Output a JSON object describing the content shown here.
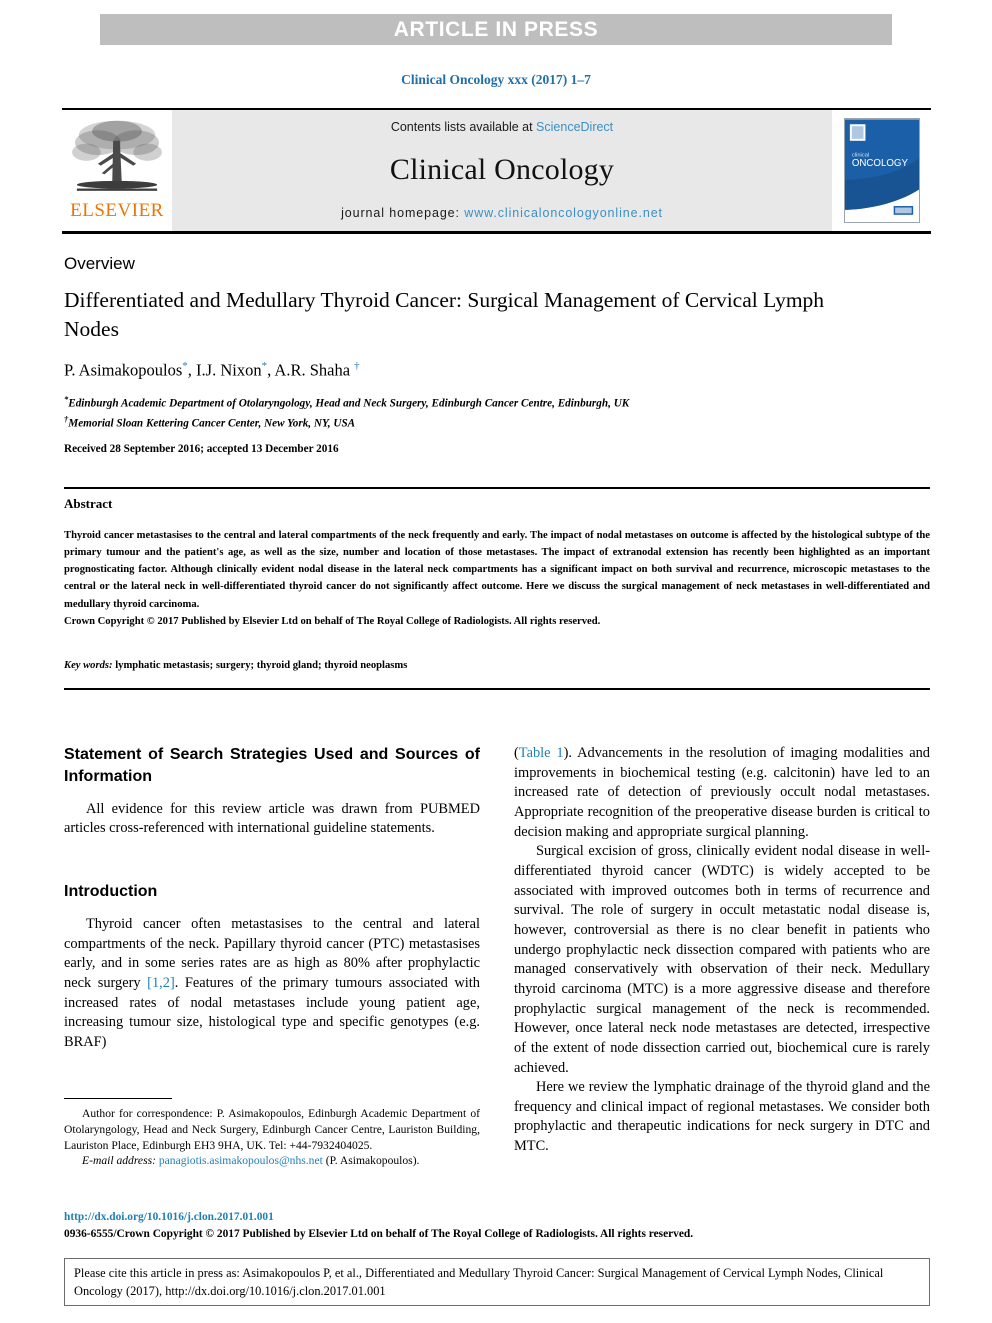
{
  "banner": {
    "label": "ARTICLE IN PRESS"
  },
  "journal_ref": "Clinical Oncology xxx (2017) 1–7",
  "masthead": {
    "publisher_name": "ELSEVIER",
    "contents_prefix": "Contents lists available at ",
    "contents_link": "ScienceDirect",
    "journal_name": "Clinical Oncology",
    "homepage_prefix": "journal homepage: ",
    "homepage_url": "www.clinicaloncologyonline.net",
    "cover_title_small": "clinical",
    "cover_title_large": "ONCOLOGY",
    "link_color": "#3b8fc4",
    "elsevier_orange": "#ec7404"
  },
  "article": {
    "section_type": "Overview",
    "title": "Differentiated and Medullary Thyroid Cancer: Surgical Management of Cervical Lymph Nodes",
    "authors": [
      {
        "name": "P. Asimakopoulos",
        "marker": "*"
      },
      {
        "name": "I.J. Nixon",
        "marker": "*"
      },
      {
        "name": "A.R. Shaha",
        "marker": "†"
      }
    ],
    "affiliations": [
      {
        "marker": "*",
        "text": "Edinburgh Academic Department of Otolaryngology, Head and Neck Surgery, Edinburgh Cancer Centre, Edinburgh, UK"
      },
      {
        "marker": "†",
        "text": "Memorial Sloan Kettering Cancer Center, New York, NY, USA"
      }
    ],
    "history": "Received 28 September 2016; accepted 13 December 2016"
  },
  "abstract": {
    "heading": "Abstract",
    "body": "Thyroid cancer metastasises to the central and lateral compartments of the neck frequently and early. The impact of nodal metastases on outcome is affected by the histological subtype of the primary tumour and the patient's age, as well as the size, number and location of those metastases. The impact of extranodal extension has recently been highlighted as an important prognosticating factor. Although clinically evident nodal disease in the lateral neck compartments has a significant impact on both survival and recurrence, microscopic metastases to the central or the lateral neck in well-differentiated thyroid cancer do not significantly affect outcome. Here we discuss the surgical management of neck metastases in well-differentiated and medullary thyroid carcinoma.",
    "copyright": "Crown Copyright © 2017 Published by Elsevier Ltd on behalf of The Royal College of Radiologists. All rights reserved.",
    "keywords_label": "Key words:",
    "keywords_value": " lymphatic metastasis; surgery; thyroid gland; thyroid neoplasms"
  },
  "body": {
    "left": {
      "heading_1": "Statement of Search Strategies Used and Sources of Information",
      "paragraph_1": "All evidence for this review article was drawn from PUBMED articles cross-referenced with international guideline statements.",
      "heading_2": "Introduction",
      "paragraph_2_part1": "Thyroid cancer often metastasises to the central and lateral compartments of the neck. Papillary thyroid cancer (PTC) metastasises early, and in some series rates are as high as 80% after prophylactic neck surgery ",
      "paragraph_2_ref": "[1,2]",
      "paragraph_2_part2": ". Features of the primary tumours associated with increased rates of nodal metastases include young patient age, increasing tumour size, histological type and specific genotypes (e.g. BRAF)"
    },
    "right": {
      "paragraph_1_ref": "Table 1",
      "paragraph_1_open": "(",
      "paragraph_1_text": "). Advancements in the resolution of imaging modalities and improvements in biochemical testing (e.g. calcitonin) have led to an increased rate of detection of previously occult nodal metastases. Appropriate recognition of the preoperative disease burden is critical to decision making and appropriate surgical planning.",
      "paragraph_2": "Surgical excision of gross, clinically evident nodal disease in well-differentiated thyroid cancer (WDTC) is widely accepted to be associated with improved outcomes both in terms of recurrence and survival. The role of surgery in occult metastatic nodal disease is, however, controversial as there is no clear benefit in patients who undergo prophylactic neck dissection compared with patients who are managed conservatively with observation of their neck. Medullary thyroid carcinoma (MTC) is a more aggressive disease and therefore prophylactic surgical management of the neck is recommended. However, once lateral neck node metastases are detected, irrespective of the extent of node dissection carried out, biochemical cure is rarely achieved.",
      "paragraph_3": "Here we review the lymphatic drainage of the thyroid gland and the frequency and clinical impact of regional metastases. We consider both prophylactic and therapeutic indications for neck surgery in DTC and MTC."
    }
  },
  "footnote": {
    "correspondence": "Author for correspondence: P. Asimakopoulos, Edinburgh Academic Department of Otolaryngology, Head and Neck Surgery, Edinburgh Cancer Centre, Lauriston Building, Lauriston Place, Edinburgh EH3 9HA, UK. Tel: +44-7932404025.",
    "email_label": "E-mail address:",
    "email_value": " panagiotis.asimakopoulos@nhs.net",
    "email_owner": " (P. Asimakopoulos)."
  },
  "footer": {
    "doi": "http://dx.doi.org/10.1016/j.clon.2017.01.001",
    "issn_copyright": "0936-6555/Crown Copyright © 2017 Published by Elsevier Ltd on behalf of The Royal College of Radiologists. All rights reserved.",
    "citation": "Please cite this article in press as: Asimakopoulos P, et al., Differentiated and Medullary Thyroid Cancer: Surgical Management of Cervical Lymph Nodes, Clinical Oncology (2017), http://dx.doi.org/10.1016/j.clon.2017.01.001"
  }
}
